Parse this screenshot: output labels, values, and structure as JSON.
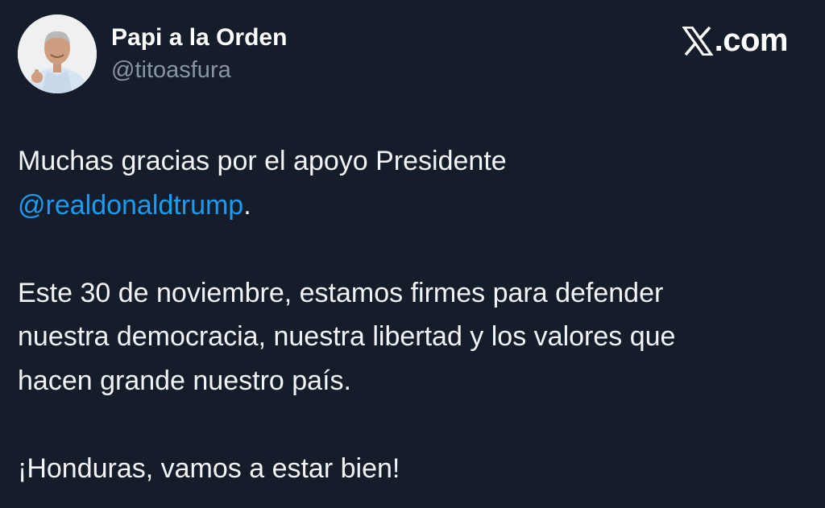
{
  "author": {
    "display_name": "Papi a la Orden",
    "handle": "@titoasfura",
    "avatar_icon": "profile-photo"
  },
  "brand": {
    "logo_icon": "x-logo-icon",
    "logo_text": ".com"
  },
  "tweet": {
    "line1": "Muchas gracias por el apoyo Presidente",
    "mention": "@realdonaldtrump",
    "mention_suffix": ".",
    "paragraph2_line1": "Este 30 de noviembre, estamos firmes para defender",
    "paragraph2_line2": "nuestra democracia, nuestra libertad y los valores que",
    "paragraph2_line3": "hacen grande nuestro país.",
    "paragraph3": "¡Honduras, vamos a estar bien!"
  },
  "colors": {
    "background": "#161d2a",
    "text": "#f2f4f7",
    "handle": "#8a95a3",
    "mention": "#1d9bf0"
  }
}
